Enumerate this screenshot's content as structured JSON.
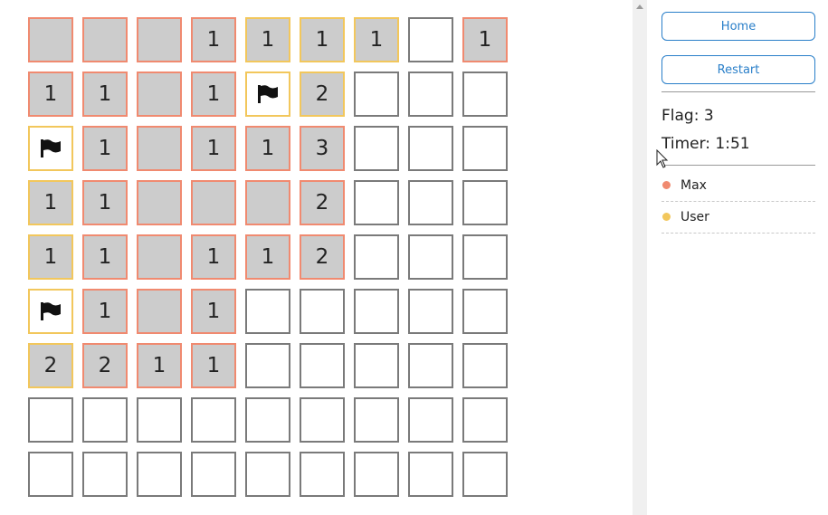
{
  "board": {
    "rows": [
      [
        {
          "s": "r",
          "o": "max"
        },
        {
          "s": "r",
          "o": "max"
        },
        {
          "s": "r",
          "o": "max"
        },
        {
          "s": "r",
          "v": "1",
          "o": "max"
        },
        {
          "s": "r",
          "v": "1",
          "o": "user"
        },
        {
          "s": "r",
          "v": "1",
          "o": "user"
        },
        {
          "s": "r",
          "v": "1",
          "o": "user"
        },
        {
          "s": "h"
        },
        {
          "s": "r",
          "v": "1",
          "o": "max"
        }
      ],
      [
        {
          "s": "r",
          "v": "1",
          "o": "max"
        },
        {
          "s": "r",
          "v": "1",
          "o": "max"
        },
        {
          "s": "r",
          "o": "max"
        },
        {
          "s": "r",
          "v": "1",
          "o": "max"
        },
        {
          "s": "f",
          "o": "user"
        },
        {
          "s": "r",
          "v": "2",
          "o": "user"
        },
        {
          "s": "h"
        },
        {
          "s": "h"
        },
        {
          "s": "h"
        }
      ],
      [
        {
          "s": "f",
          "o": "user"
        },
        {
          "s": "r",
          "v": "1",
          "o": "max"
        },
        {
          "s": "r",
          "o": "max"
        },
        {
          "s": "r",
          "v": "1",
          "o": "max"
        },
        {
          "s": "r",
          "v": "1",
          "o": "max"
        },
        {
          "s": "r",
          "v": "3",
          "o": "max"
        },
        {
          "s": "h"
        },
        {
          "s": "h"
        },
        {
          "s": "h"
        }
      ],
      [
        {
          "s": "r",
          "v": "1",
          "o": "user"
        },
        {
          "s": "r",
          "v": "1",
          "o": "max"
        },
        {
          "s": "r",
          "o": "max"
        },
        {
          "s": "r",
          "o": "max"
        },
        {
          "s": "r",
          "o": "max"
        },
        {
          "s": "r",
          "v": "2",
          "o": "max"
        },
        {
          "s": "h"
        },
        {
          "s": "h"
        },
        {
          "s": "h"
        }
      ],
      [
        {
          "s": "r",
          "v": "1",
          "o": "user"
        },
        {
          "s": "r",
          "v": "1",
          "o": "max"
        },
        {
          "s": "r",
          "o": "max"
        },
        {
          "s": "r",
          "v": "1",
          "o": "max"
        },
        {
          "s": "r",
          "v": "1",
          "o": "max"
        },
        {
          "s": "r",
          "v": "2",
          "o": "max"
        },
        {
          "s": "h"
        },
        {
          "s": "h"
        },
        {
          "s": "h"
        }
      ],
      [
        {
          "s": "f",
          "o": "user"
        },
        {
          "s": "r",
          "v": "1",
          "o": "max"
        },
        {
          "s": "r",
          "o": "max"
        },
        {
          "s": "r",
          "v": "1",
          "o": "max"
        },
        {
          "s": "h"
        },
        {
          "s": "h"
        },
        {
          "s": "h"
        },
        {
          "s": "h"
        },
        {
          "s": "h"
        }
      ],
      [
        {
          "s": "r",
          "v": "2",
          "o": "user"
        },
        {
          "s": "r",
          "v": "2",
          "o": "max"
        },
        {
          "s": "r",
          "v": "1",
          "o": "max"
        },
        {
          "s": "r",
          "v": "1",
          "o": "max"
        },
        {
          "s": "h"
        },
        {
          "s": "h"
        },
        {
          "s": "h"
        },
        {
          "s": "h"
        },
        {
          "s": "h"
        }
      ],
      [
        {
          "s": "h"
        },
        {
          "s": "h"
        },
        {
          "s": "h"
        },
        {
          "s": "h"
        },
        {
          "s": "h"
        },
        {
          "s": "h"
        },
        {
          "s": "h"
        },
        {
          "s": "h"
        },
        {
          "s": "h"
        }
      ],
      [
        {
          "s": "h"
        },
        {
          "s": "h"
        },
        {
          "s": "h"
        },
        {
          "s": "h"
        },
        {
          "s": "h"
        },
        {
          "s": "h"
        },
        {
          "s": "h"
        },
        {
          "s": "h"
        },
        {
          "s": "h"
        }
      ]
    ]
  },
  "colors": {
    "max": "#f08a70",
    "user": "#f2c75c",
    "hidden_border": "#7a7a7a",
    "revealed_bg": "#cccccc",
    "button_accent": "#2a7fc9"
  },
  "controls": {
    "home_label": "Home",
    "restart_label": "Restart"
  },
  "stats": {
    "flag_text": "Flag: 3",
    "timer_text": "Timer: 1:51"
  },
  "players": [
    {
      "name": "Max",
      "key": "max"
    },
    {
      "name": "User",
      "key": "user"
    }
  ],
  "icons": {
    "flag": "flag-icon",
    "scroll": "scroll-up-arrow-icon",
    "cursor": "mouse-pointer-icon"
  }
}
